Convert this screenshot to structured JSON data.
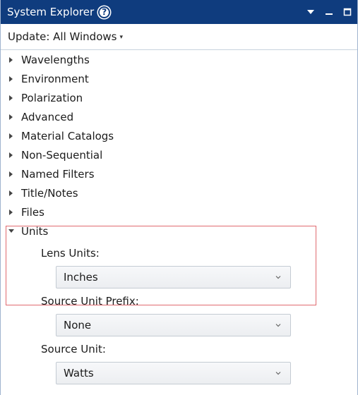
{
  "window": {
    "title": "System Explorer",
    "help_glyph": "?",
    "controls": [
      "dropdown-icon",
      "minimize-icon",
      "maximize-icon"
    ]
  },
  "update": {
    "label": "Update: All Windows",
    "caret": "▾"
  },
  "tree": {
    "collapsed_items": [
      "Wavelengths",
      "Environment",
      "Polarization",
      "Advanced",
      "Material Catalogs",
      "Non-Sequential",
      "Named Filters",
      "Title/Notes",
      "Files"
    ],
    "expanded": {
      "label": "Units",
      "fields": [
        {
          "label": "Lens Units:",
          "value": "Inches"
        },
        {
          "label": "Source Unit Prefix:",
          "value": "None"
        },
        {
          "label": "Source Unit:",
          "value": "Watts"
        }
      ]
    }
  },
  "colors": {
    "titlebar": "#0f3c7e",
    "highlight": "#e06a6f"
  }
}
